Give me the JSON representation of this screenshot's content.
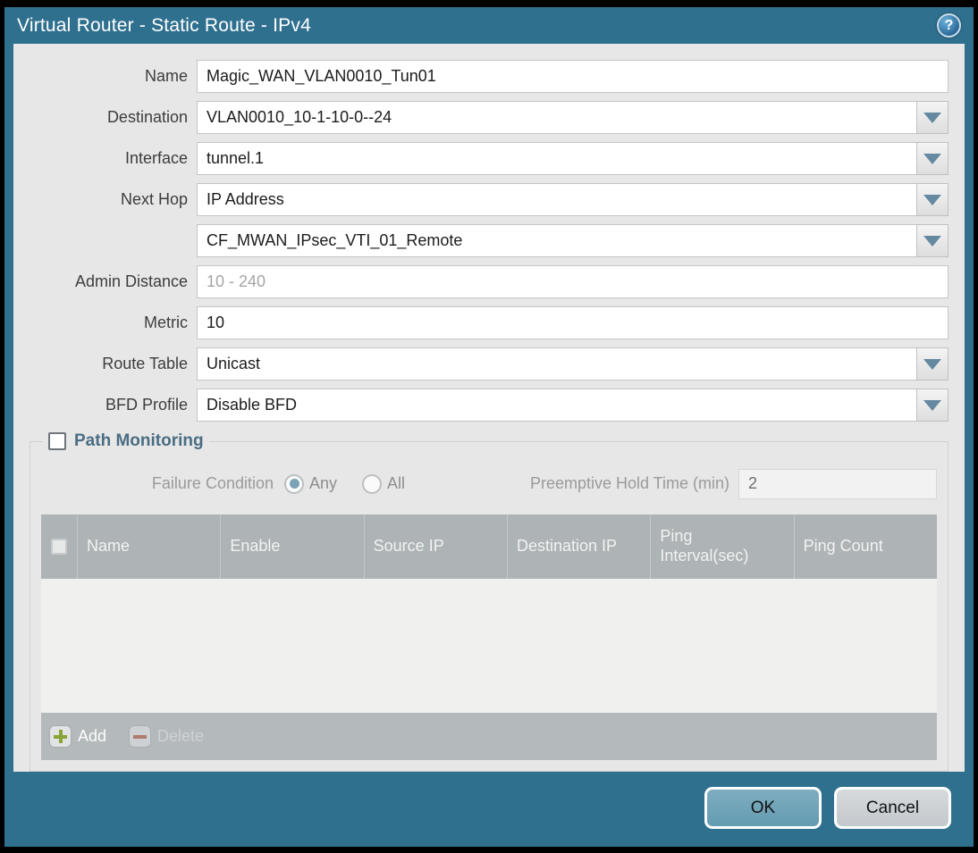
{
  "window": {
    "title": "Virtual Router - Static Route - IPv4"
  },
  "colors": {
    "titlebar": "#30708f",
    "content_bg": "#e7e7e7",
    "table_header_bg": "#aeb3b6",
    "ok_button": "#6fa5ba",
    "cancel_button": "#ccd1d5",
    "add_icon_green": "#8aa437",
    "delete_icon_red": "#b07a70",
    "radio_selected": "#7ba3b4"
  },
  "form": {
    "name": {
      "label": "Name",
      "value": "Magic_WAN_VLAN0010_Tun01"
    },
    "destination": {
      "label": "Destination",
      "value": "VLAN0010_10-1-10-0--24"
    },
    "interface": {
      "label": "Interface",
      "value": "tunnel.1"
    },
    "next_hop": {
      "label": "Next Hop",
      "value": "IP Address"
    },
    "next_hop_address": {
      "value": "CF_MWAN_IPsec_VTI_01_Remote"
    },
    "admin_distance": {
      "label": "Admin Distance",
      "placeholder": "10 - 240"
    },
    "metric": {
      "label": "Metric",
      "value": "10"
    },
    "route_table": {
      "label": "Route Table",
      "value": "Unicast"
    },
    "bfd_profile": {
      "label": "BFD Profile",
      "value": "Disable BFD"
    }
  },
  "path_monitoring": {
    "title": "Path Monitoring",
    "enabled": false,
    "failure_condition": {
      "label": "Failure Condition",
      "options": [
        {
          "label": "Any",
          "selected": true
        },
        {
          "label": "All",
          "selected": false
        }
      ]
    },
    "preemptive_hold_time": {
      "label": "Preemptive Hold Time (min)",
      "value": "2"
    },
    "table": {
      "columns": [
        "Name",
        "Enable",
        "Source IP",
        "Destination IP",
        "Ping Interval(sec)",
        "Ping Count"
      ],
      "rows": []
    },
    "toolbar": {
      "add_label": "Add",
      "delete_label": "Delete"
    }
  },
  "footer": {
    "ok_label": "OK",
    "cancel_label": "Cancel"
  }
}
